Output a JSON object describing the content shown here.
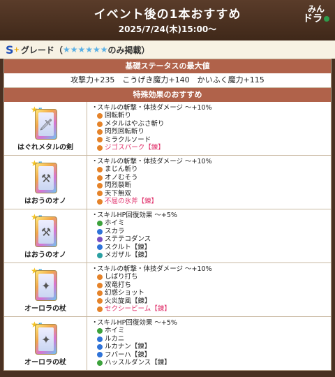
{
  "header": {
    "title": "イベント後の1本おすすめ",
    "date": "2025/7/24(木)15:00〜",
    "logo_line1": "みん",
    "logo_line2": "ドラ"
  },
  "grade": {
    "letter": "S",
    "plus": "+",
    "label": "グレード（",
    "stars": "★★★★★★",
    "suffix": "のみ掲載）"
  },
  "table": {
    "base_header": "基礎ステータスの最大値",
    "stats": "攻撃力+235　こうげき魔力+140　かいふく魔力+115",
    "effect_header": "特殊効果のおすすめ",
    "rows": [
      {
        "name": "はぐれメタルの剣",
        "stars": "5",
        "icon": "sword-icon",
        "effects": [
          {
            "text": "スキルの斬撃・体技ダメージ 〜+10%",
            "bullet": "・",
            "color": "",
            "pink": false
          },
          {
            "text": "回転斬り",
            "color": "orange",
            "pink": false
          },
          {
            "text": "メタルはやぶさ斬り",
            "color": "orange",
            "pink": false
          },
          {
            "text": "閃烈回転斬り",
            "color": "orange",
            "pink": false
          },
          {
            "text": "ミラクルソード",
            "color": "orange",
            "pink": false
          },
          {
            "text": "ジゴスパーク【錬】",
            "color": "orange",
            "pink": true
          }
        ]
      },
      {
        "name": "はおうのオノ",
        "stars": "5",
        "icon": "axe-icon",
        "effects": [
          {
            "text": "スキルの斬撃・体技ダメージ 〜+10%",
            "bullet": "・",
            "color": "",
            "pink": false
          },
          {
            "text": "まじん斬り",
            "color": "orange",
            "pink": false
          },
          {
            "text": "オノむそう",
            "color": "orange",
            "pink": false
          },
          {
            "text": "閃烈裂断",
            "color": "orange",
            "pink": false
          },
          {
            "text": "天下無双",
            "color": "orange",
            "pink": false
          },
          {
            "text": "不屈の氷斧【錬】",
            "color": "orange",
            "pink": true
          }
        ]
      },
      {
        "name": "はおうのオノ",
        "stars": "5",
        "icon": "axe-icon",
        "effects": [
          {
            "text": "スキルHP回復効果 〜+5%",
            "bullet": "・",
            "color": "",
            "pink": false
          },
          {
            "text": "ホイミ",
            "color": "green",
            "pink": false
          },
          {
            "text": "スカラ",
            "color": "blue",
            "pink": false
          },
          {
            "text": "ステテコダンス",
            "color": "purple",
            "pink": false
          },
          {
            "text": "スクルト【錬】",
            "color": "blue",
            "pink": false
          },
          {
            "text": "メガザル【錬】",
            "color": "teal",
            "pink": false
          }
        ]
      },
      {
        "name": "オーロラの杖",
        "stars": "5",
        "icon": "staff-icon",
        "effects": [
          {
            "text": "スキルの斬撃・体技ダメージ 〜+10%",
            "bullet": "・",
            "color": "",
            "pink": false
          },
          {
            "text": "しばり打ち",
            "color": "orange",
            "pink": false
          },
          {
            "text": "双竜打ち",
            "color": "orange",
            "pink": false
          },
          {
            "text": "幻惑ショット",
            "color": "orange",
            "pink": false
          },
          {
            "text": "火炎旋風【錬】",
            "color": "orange",
            "pink": false
          },
          {
            "text": "セクシービーム【錬】",
            "color": "orange",
            "pink": true
          }
        ]
      },
      {
        "name": "オーロラの杖",
        "stars": "5",
        "icon": "staff-icon",
        "effects": [
          {
            "text": "スキルHP回復効果 〜+5%",
            "bullet": "・",
            "color": "",
            "pink": false
          },
          {
            "text": "ホイミ",
            "color": "green",
            "pink": false
          },
          {
            "text": "ルカニ",
            "color": "blue",
            "pink": false
          },
          {
            "text": "ルカナン【錬】",
            "color": "blue",
            "pink": false
          },
          {
            "text": "フバーハ【錬】",
            "color": "blue",
            "pink": false
          },
          {
            "text": "ハッスルダンス【錬】",
            "color": "green",
            "pink": false
          }
        ]
      }
    ]
  }
}
